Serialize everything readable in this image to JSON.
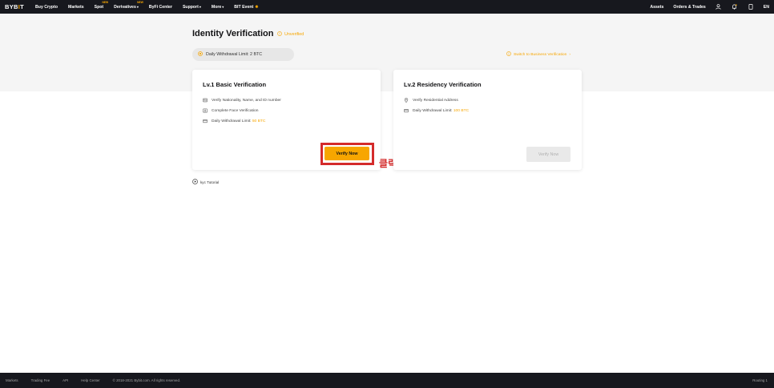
{
  "nav": {
    "logo_prefix": "BYB",
    "logo_mark": "I",
    "logo_suffix": "T",
    "items": [
      {
        "label": "Buy Crypto"
      },
      {
        "label": "Markets"
      },
      {
        "label": "Spot",
        "badge": "NEW"
      },
      {
        "label": "Derivatives",
        "badge": "NEW",
        "caret": true
      },
      {
        "label": "ByFi Center"
      },
      {
        "label": "Support",
        "caret": true
      },
      {
        "label": "More",
        "caret": true
      },
      {
        "label": "BIT Event"
      }
    ],
    "right": {
      "assets": "Assets",
      "orders": "Orders & Trades",
      "lang": "EN"
    }
  },
  "header": {
    "title": "Identity Verification",
    "status": "Unverified",
    "limit_text": "Daily Withdrawal Limit:  2 BTC",
    "switch_link": "Switch to Business Verification"
  },
  "cards": [
    {
      "title": "Lv.1 Basic Verification",
      "features": [
        {
          "icon": "id-card-icon",
          "text": "Verify Nationality, Name, and ID number"
        },
        {
          "icon": "face-scan-icon",
          "text": "Complete Face Verification"
        },
        {
          "icon": "wallet-icon",
          "label": "Daily Withdrawal Limit: ",
          "value": "50 BTC"
        }
      ],
      "button": "Verify Now",
      "button_enabled": true
    },
    {
      "title": "Lv.2 Residency Verification",
      "features": [
        {
          "icon": "location-pin-icon",
          "text": "Verify Residential Address"
        },
        {
          "icon": "wallet-icon",
          "label": "Daily Withdrawal Limit: ",
          "value": "100 BTC"
        }
      ],
      "button": "Verify Now",
      "button_enabled": false
    }
  ],
  "annotation": "클릭",
  "tutorial": "kyc Tutorial",
  "footer": {
    "links": [
      "Markets",
      "Trading Fee",
      "API",
      "Help Center"
    ],
    "copyright": "© 2018-2021 Bybit.com. All rights reserved.",
    "routing": "Routing 1"
  },
  "colors": {
    "accent": "#f7a600",
    "nav_bg": "#17181e",
    "highlight": "#d42b2b"
  }
}
